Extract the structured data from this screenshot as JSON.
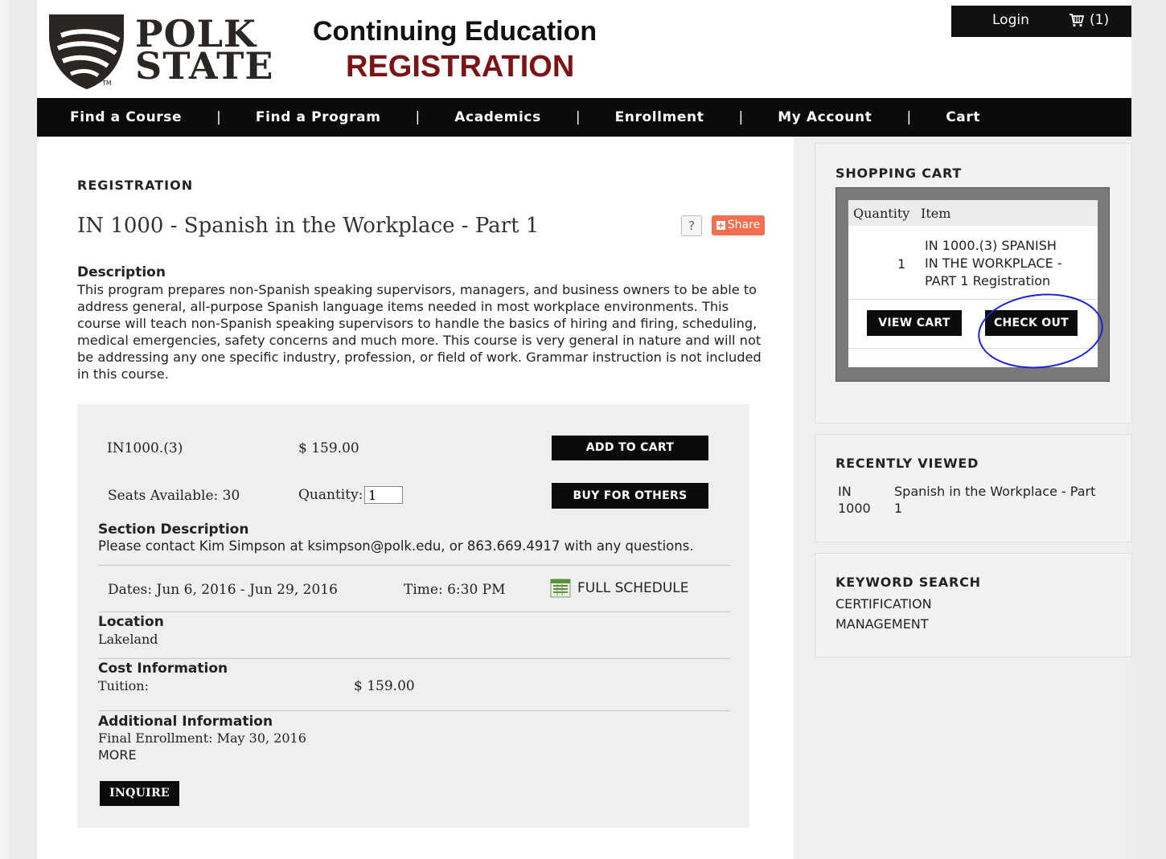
{
  "brand": {
    "logo_line1": "POLK",
    "logo_line2": "STATE",
    "tm": "TM",
    "title": "Continuing Education",
    "subtitle": "REGISTRATION",
    "accent_color": "#7a1416"
  },
  "topbar": {
    "login": "Login",
    "cart": "(1)"
  },
  "nav": {
    "items": [
      "Find a Course",
      "Find a Program",
      "Academics",
      "Enrollment",
      "My Account",
      "Cart"
    ],
    "sep": "|"
  },
  "main": {
    "heading": "REGISTRATION",
    "course_title": "IN 1000 - Spanish in the Workplace - Part 1",
    "help": "?",
    "share": "Share",
    "desc_label": "Description",
    "description": "This program prepares non-Spanish speaking supervisors, managers, and business owners to be able to address general, all-purpose Spanish language items needed in most workplace environments. This course will teach non-Spanish speaking supervisors to handle the basics of hiring and firing, scheduling, medical emergencies, safety concerns and much more. This course is very general in nature and will not be addressing any one specific industry, profession, or field of work. Grammar instruction is not included in this course."
  },
  "section": {
    "code": "IN1000.(3)",
    "price": "$ 159.00",
    "add_to_cart": "ADD TO CART",
    "seats": "Seats Available: 30",
    "quantity_label": "Quantity:",
    "quantity_value": "1",
    "buy_for_others": "BUY FOR OTHERS",
    "section_desc_label": "Section Description",
    "section_desc": "Please contact Kim Simpson at ksimpson@polk.edu, or 863.669.4917 with any questions.",
    "dates": "Dates: Jun 6, 2016 - Jun 29, 2016",
    "time": "Time: 6:30 PM",
    "full_schedule": "FULL SCHEDULE",
    "location_label": "Location",
    "location": "Lakeland",
    "cost_label": "Cost Information",
    "tuition_label": "Tuition:",
    "tuition": "$ 159.00",
    "additional_label": "Additional Information",
    "final_enrollment": "Final Enrollment: May 30, 2016",
    "more": "MORE",
    "inquire": "INQUIRE"
  },
  "sidebar": {
    "cart_title": "SHOPPING CART",
    "col_quantity": "Quantity",
    "col_item": "Item",
    "item_qty": "1",
    "item_line1": "IN 1000.(3) SPANISH",
    "item_line2": "IN THE WORKPLACE -",
    "item_line3": "PART 1 Registration",
    "view_cart": "VIEW CART",
    "check_out": "CHECK OUT",
    "recent_title": "RECENTLY VIEWED",
    "recent_code1": "IN",
    "recent_code2": "1000",
    "recent_name1": "Spanish in the Workplace - Part",
    "recent_name2": "1",
    "keyword_title": "KEYWORD SEARCH",
    "keywords": [
      "CERTIFICATION",
      "MANAGEMENT"
    ]
  }
}
